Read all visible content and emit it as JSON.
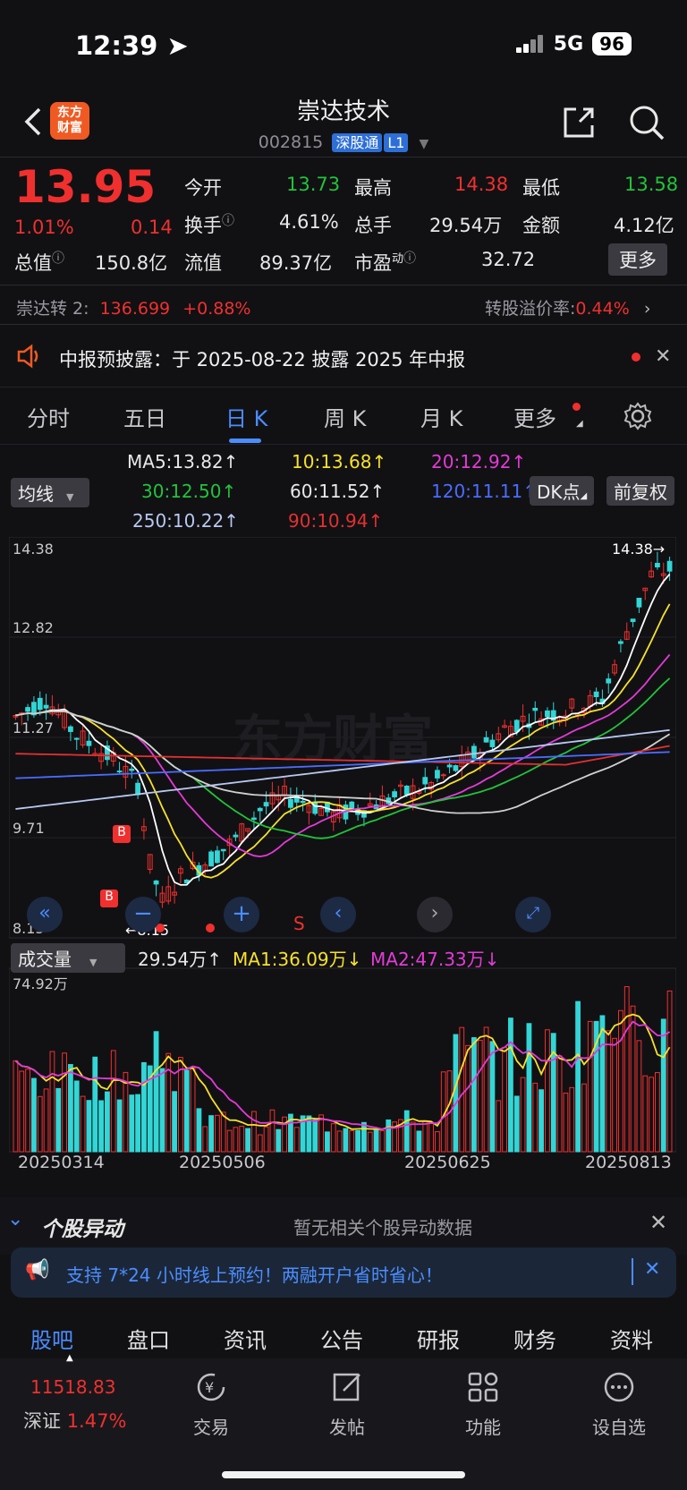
{
  "status": {
    "time": "12:39",
    "network": "5G",
    "battery": "96"
  },
  "header": {
    "logo_line1": "东方",
    "logo_line2": "财富",
    "name": "崇达技术",
    "code": "002815",
    "tag": "深股通",
    "level": "L1"
  },
  "quote": {
    "price": "13.95",
    "change_pct": "1.01%",
    "change": "0.14",
    "open_label": "今开",
    "open": "13.73",
    "high_label": "最高",
    "high": "14.38",
    "low_label": "最低",
    "low": "13.58",
    "turnover_label": "换手",
    "turnover": "4.61%",
    "volume_label": "总手",
    "volume": "29.54万",
    "amount_label": "金额",
    "amount": "4.12亿",
    "mktcap_label": "总值",
    "mktcap": "150.8亿",
    "float_label": "流值",
    "float": "89.37亿",
    "pe_label": "市盈",
    "pe_sup": "动",
    "pe": "32.72",
    "more_label": "更多"
  },
  "bond": {
    "name": "崇达转 2:",
    "price": "136.699",
    "change": "+0.88%",
    "premium_label": "转股溢价率:",
    "premium": "0.44%"
  },
  "announce": {
    "text": "中报预披露：于 2025-08-22 披露 2025 年中报"
  },
  "kline_tabs": [
    "分时",
    "五日",
    "日 K",
    "周 K",
    "月 K",
    "更多"
  ],
  "ma_legend": {
    "selector": "均线",
    "ma5": "MA5:13.82↑",
    "ma10": "10:13.68↑",
    "ma20": "20:12.92↑",
    "ma30": "30:12.50↑",
    "ma60": "60:11.52↑",
    "ma120": "120:11.11↑",
    "ma250": "250:10.22↑",
    "ma90": "90:10.94↑",
    "dk": "DK点",
    "adjust": "前复权"
  },
  "chart": {
    "price_labels": [
      "14.38",
      "12.82",
      "11.27",
      "9.71",
      "8.15"
    ],
    "max_marker": "14.38→",
    "min_marker": "←8.15",
    "watermark": "东方财富",
    "b_marker": "B",
    "s_marker": "S",
    "colors": {
      "up": "#f0302e",
      "down": "#33d6d6",
      "ma5": "#ffffff",
      "ma10": "#f7e12a",
      "ma20": "#e43ad6",
      "ma30": "#22c33a",
      "ma60": "#d0d0d0",
      "ma90": "#e43030",
      "ma120": "#4b6cff",
      "ma250": "#b8c8f0"
    }
  },
  "volume": {
    "selector": "成交量",
    "value": "29.54万↑",
    "ma1": "MA1:36.09万↓",
    "ma2": "MA2:47.33万↓",
    "max_label": "74.92万"
  },
  "dates": [
    "20250314",
    "20250506",
    "20250625",
    "20250813"
  ],
  "abnormal": {
    "title": "个股异动",
    "text": "暂无相关个股异动数据"
  },
  "promo": {
    "text": "支持 7*24 小时线上预约！两融开户省时省心！"
  },
  "bottom_tabs": [
    "股吧",
    "盘口",
    "资讯",
    "公告",
    "研报",
    "财务",
    "资料"
  ],
  "nav": {
    "index_value": "11518.83",
    "index_name": "深证",
    "index_change": "1.47%",
    "items": [
      "交易",
      "发帖",
      "功能",
      "设自选"
    ]
  }
}
